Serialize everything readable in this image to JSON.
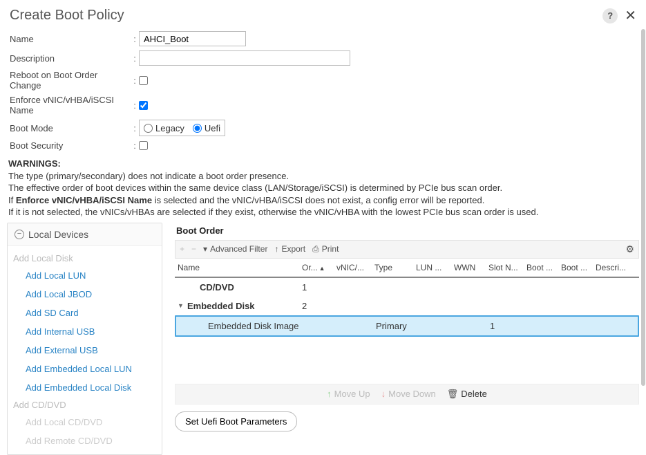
{
  "header": {
    "title": "Create Boot Policy"
  },
  "form": {
    "name_label": "Name",
    "name_value": "AHCI_Boot",
    "desc_label": "Description",
    "desc_value": "",
    "reboot_label": "Reboot on Boot Order Change",
    "reboot_checked": false,
    "enforce_label": "Enforce vNIC/vHBA/iSCSI Name",
    "enforce_checked": true,
    "mode_label": "Boot Mode",
    "mode_legacy": "Legacy",
    "mode_uefi": "Uefi",
    "mode_selected": "uefi",
    "security_label": "Boot Security",
    "security_checked": false
  },
  "warnings": {
    "title": "WARNINGS:",
    "l1": "The type (primary/secondary) does not indicate a boot order presence.",
    "l2": "The effective order of boot devices within the same device class (LAN/Storage/iSCSI) is determined by PCIe bus scan order.",
    "l3a": "If ",
    "l3b": "Enforce vNIC/vHBA/iSCSI Name",
    "l3c": " is selected and the vNIC/vHBA/iSCSI does not exist, a config error will be reported.",
    "l4": "If it is not selected, the vNICs/vHBAs are selected if they exist, otherwise the vNIC/vHBA with the lowest PCIe bus scan order is used."
  },
  "sidebar": {
    "title": "Local Devices",
    "group_disk": "Add Local Disk",
    "items_disk": [
      "Add Local LUN",
      "Add Local JBOD",
      "Add SD Card",
      "Add Internal USB",
      "Add External USB",
      "Add Embedded Local LUN",
      "Add Embedded Local Disk"
    ],
    "group_cd": "Add CD/DVD",
    "items_cd": [
      "Add Local CD/DVD",
      "Add Remote CD/DVD"
    ]
  },
  "boot_order": {
    "title": "Boot Order",
    "toolbar": {
      "advanced_filter": "Advanced Filter",
      "export": "Export",
      "print": "Print"
    },
    "cols": {
      "name": "Name",
      "order": "Or...",
      "vnic": "vNIC/...",
      "type": "Type",
      "lun": "LUN ...",
      "wwn": "WWN",
      "slot": "Slot N...",
      "bootn": "Boot ...",
      "bootp": "Boot ...",
      "desc": "Descri..."
    },
    "rows": [
      {
        "name": "CD/DVD",
        "order": "1",
        "type": "",
        "slot": "",
        "bold": true,
        "indent": 1,
        "expandable": false
      },
      {
        "name": "Embedded Disk",
        "order": "2",
        "type": "",
        "slot": "",
        "bold": true,
        "indent": 1,
        "expandable": true
      },
      {
        "name": "Embedded Disk Image",
        "order": "",
        "type": "Primary",
        "slot": "1",
        "bold": false,
        "indent": 2,
        "expandable": false,
        "selected": true
      }
    ],
    "actions": {
      "move_up": "Move Up",
      "move_down": "Move Down",
      "delete": "Delete"
    },
    "uefi_button": "Set Uefi Boot Parameters"
  }
}
